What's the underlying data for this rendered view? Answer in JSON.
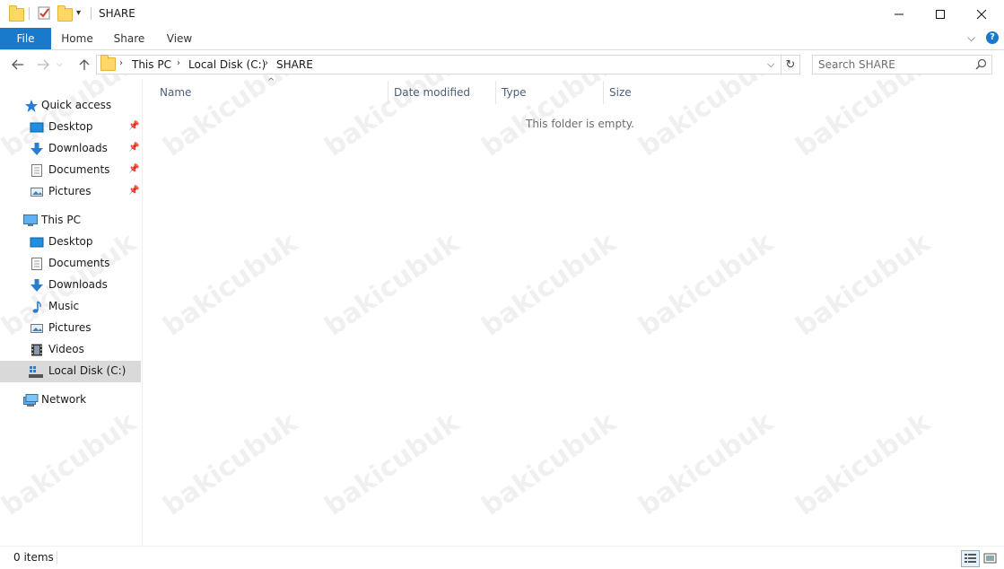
{
  "window": {
    "title": "SHARE",
    "controls": [
      "minimize",
      "maximize",
      "close"
    ]
  },
  "ribbon": {
    "tabs": [
      {
        "label": "File",
        "active": true
      },
      {
        "label": "Home"
      },
      {
        "label": "Share"
      },
      {
        "label": "View"
      }
    ]
  },
  "address": {
    "breadcrumbs": [
      "This PC",
      "Local Disk (C:)",
      "SHARE"
    ]
  },
  "search": {
    "placeholder": "Search SHARE"
  },
  "sidebar": {
    "quick_access": {
      "label": "Quick access",
      "items": [
        {
          "label": "Desktop",
          "pinned": true
        },
        {
          "label": "Downloads",
          "pinned": true
        },
        {
          "label": "Documents",
          "pinned": true
        },
        {
          "label": "Pictures",
          "pinned": true
        }
      ]
    },
    "this_pc": {
      "label": "This PC",
      "items": [
        {
          "label": "Desktop"
        },
        {
          "label": "Documents"
        },
        {
          "label": "Downloads"
        },
        {
          "label": "Music"
        },
        {
          "label": "Pictures"
        },
        {
          "label": "Videos"
        },
        {
          "label": "Local Disk (C:)",
          "selected": true
        }
      ]
    },
    "network": {
      "label": "Network"
    }
  },
  "content": {
    "columns": [
      "Name",
      "Date modified",
      "Type",
      "Size"
    ],
    "empty_message": "This folder is empty."
  },
  "status": {
    "item_count": "0 items"
  },
  "watermark": "bakicubuk",
  "colors": {
    "accent": "#1979ca",
    "selected_bg": "#d9d9d9",
    "column_header": "#4c607a"
  }
}
